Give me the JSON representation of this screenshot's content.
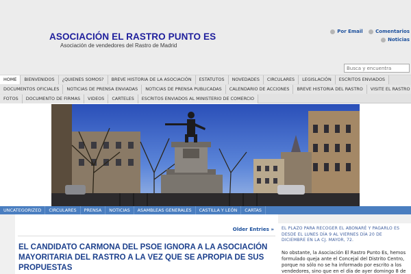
{
  "header": {
    "title": "ASOCIACIÓN EL RASTRO PUNTO ES",
    "description": "Asociación de vendedores del Rastro de Madrid",
    "feeds": {
      "email": "Por Email",
      "comments": "Comentarios",
      "news": "Noticias"
    },
    "search_placeholder": "Busca y encuentra"
  },
  "page_nav": {
    "row1": [
      "HOME",
      "BIENVENIDOS",
      "¿QUIENES SOMOS?",
      "BREVE HISTORIA DE LA ASOCIACIÓN",
      "ESTATUTOS",
      "NOVEDADES",
      "CIRCULARES",
      "LEGISLACIÓN",
      "ESCRITOS ENVIADOS"
    ],
    "row2": [
      "DOCUMENTOS OFICIALES",
      "NOTICIAS DE PRENSA ENVIADAS",
      "NOTICIAS DE PRENSA PUBLICADAS",
      "CALENDARIO DE ACCIONES",
      "BREVE HISTORIA DEL RASTRO",
      "VISITE EL RASTRO"
    ],
    "row3": [
      "FOTOS",
      "DOCUMENTO DE FIRMAS",
      "VIDEOS",
      "CARTELES",
      "ESCRITOS ENVIADOS AL MINISTERIO DE COMERCIO"
    ],
    "active": "HOME"
  },
  "category_nav": [
    "UNCATEGORIZED",
    "CIRCULARES",
    "PRENSA",
    "NOTICIAS",
    "ASAMBLEAS GENERALES",
    "CASTILLA Y LEÓN",
    "CARTAS"
  ],
  "content": {
    "older_entries": "Older Entries »",
    "post_title": "EL CANDIDATO CARMONA DEL PSOE IGNORA A LA ASOCIACIÓN MAYORITARIA DEL RASTRO A LA VEZ QUE SE APROPIA DE SUS PROPUESTAS"
  },
  "sidebar": {
    "notice": "EL PLAZO PARA RECOGER EL ABONARÉ Y PAGARLO ES DESDE EL LUNES DÍA 9 AL VIERNES DÍA 20 DE DICIEMBRE EN LA CJ. MAYOR, 72.",
    "text": "No obstante, la Asociación El Rastro Punto Es, hemos formulado queja ante el Concejal del Distrito Centro, porque no sólo no se ha informado por escrito a los vendedores, sino que en el día de ayer domingo 8 de diciembre, los"
  },
  "colors": {
    "title": "#1e1e9c",
    "link": "#1b4f9c",
    "category_bar": "#4a7ec0",
    "post_title": "#1b3f8c"
  }
}
